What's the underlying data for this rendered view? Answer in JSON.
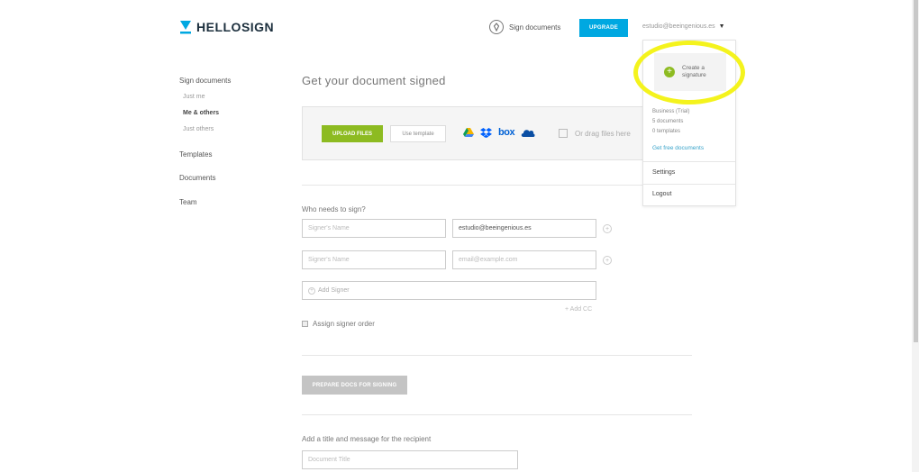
{
  "header": {
    "logo_text": "HELLOSIGN",
    "sign_documents_label": "Sign documents",
    "upgrade_label": "UPGRADE",
    "account_email": "estudio@beeingenious.es",
    "accent_color": "#00a8e1",
    "brand_color": "#1c2f3d"
  },
  "sidebar": {
    "sign_documents": "Sign documents",
    "just_me": "Just me",
    "me_and_others": "Me & others",
    "just_others": "Just others",
    "templates": "Templates",
    "documents": "Documents",
    "team": "Team"
  },
  "main": {
    "title": "Get your document signed",
    "upload_files": "UPLOAD FILES",
    "use_template": "Use template",
    "cloud_services": [
      "google-drive-icon",
      "dropbox-icon",
      "box-icon",
      "onedrive-icon"
    ],
    "box_text": "box",
    "drag_text": "Or drag files here",
    "who_needs_to_sign": "Who needs to sign?",
    "signers": [
      {
        "name_placeholder": "Signer's Name",
        "email_value": "estudio@beeingenious.es",
        "email_placeholder": ""
      },
      {
        "name_placeholder": "Signer's Name",
        "email_value": "",
        "email_placeholder": "email@example.com"
      }
    ],
    "add_signer": "Add Signer",
    "add_cc": "+ Add CC",
    "assign_order": "Assign signer order",
    "prepare_docs": "PREPARE DOCS FOR SIGNING",
    "add_title_message": "Add a title and message for the recipient",
    "document_title_placeholder": "Document Title",
    "upload_button_color": "#8dbb21"
  },
  "dropdown": {
    "create_signature_line1": "Create a",
    "create_signature_line2": "signature",
    "plan_name": "Business (Trial)",
    "documents_count": "5 documents",
    "templates_count": "0 templates",
    "get_free_documents": "Get free documents",
    "settings": "Settings",
    "logout": "Logout",
    "highlight_color": "#f4f31d"
  }
}
